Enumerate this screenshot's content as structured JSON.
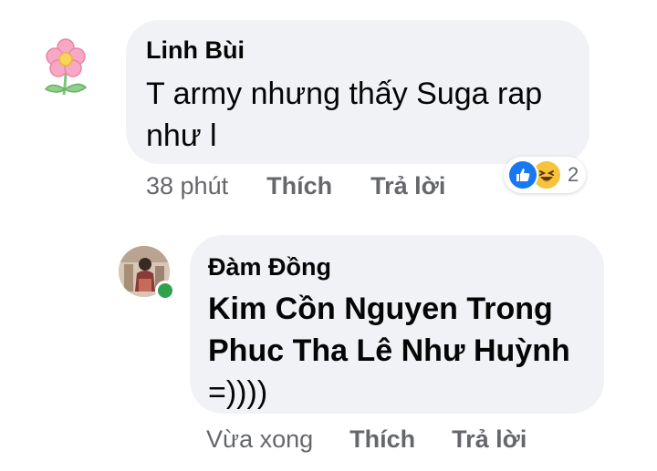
{
  "comments": [
    {
      "author": "Linh Bùi",
      "text": "T army nhưng thấy Suga rap như l",
      "time": "38 phút",
      "like_label": "Thích",
      "reply_label": "Trả lời",
      "reactions": {
        "types": [
          "like-icon",
          "haha-icon"
        ],
        "count": "2"
      }
    },
    {
      "author": "Đàm Đồng",
      "text_bold": "Kim Cồn Nguyen Trong Phuc Tha Lê Như Huỳnh",
      "text_tail": "=))))",
      "time": "Vừa xong",
      "like_label": "Thích",
      "reply_label": "Trả lời",
      "online": true
    }
  ],
  "colors": {
    "bubble": "#f0f2f5",
    "meta": "#65676b",
    "like_blue": "#1877f2",
    "haha_yellow": "#f7c33d",
    "online_green": "#31a24c"
  }
}
